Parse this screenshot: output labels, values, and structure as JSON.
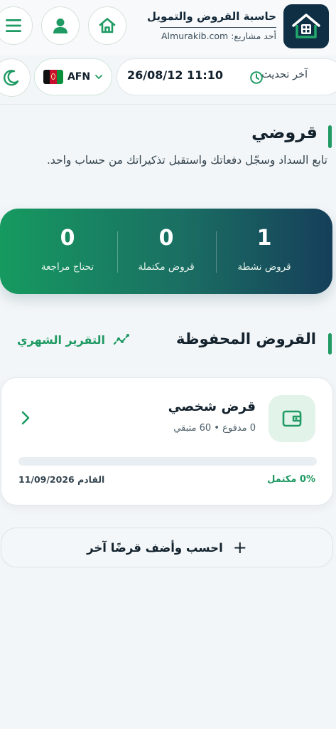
{
  "header": {
    "brand_title": "حاسبة القروض والتمويل",
    "brand_sub": "أحد مشاريع: Almurakib.com",
    "logo_icon": "house-calculator-logo",
    "home_icon": "home-icon",
    "user_icon": "user-icon",
    "menu_icon": "menu-icon"
  },
  "status": {
    "theme_icon": "moon-icon",
    "currency_code": "AFN",
    "last_update_label": "آخر تحديث",
    "last_update_value": "26/08/12 11:10"
  },
  "page": {
    "title": "قروضي",
    "description": "تابع السداد وسجّل دفعاتك واستقبل تذكيراتك من حساب واحد."
  },
  "stats": [
    {
      "value": "1",
      "label": "قروض نشطة"
    },
    {
      "value": "0",
      "label": "قروض مكتملة"
    },
    {
      "value": "0",
      "label": "تحتاج مراجعة"
    }
  ],
  "saved": {
    "title": "القروض المحفوظة",
    "report_label": "التقرير الشهري"
  },
  "loan": {
    "name": "قرض شخصي",
    "meta": "0 مدفوع • 60 متبقي",
    "progress_percent": 0,
    "progress_label": "0% مكتمل",
    "next_label": "القادم 11/09/2026"
  },
  "add_loan": {
    "label": "احسب وأضف قرضًا آخر"
  },
  "colors": {
    "accent": "#1f9a63",
    "navy": "#0f2f45",
    "gradient_start": "#169a60",
    "gradient_end": "#163f5a"
  }
}
